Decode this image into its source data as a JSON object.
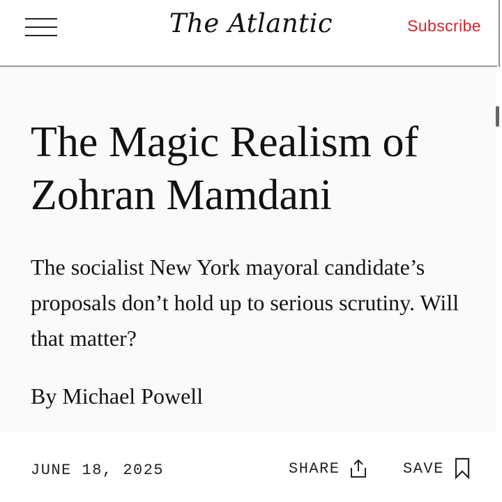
{
  "header": {
    "menu_icon": "hamburger-menu-icon",
    "logo_text": "The Atlantic",
    "subscribe_label": "Subscribe",
    "subscribe_color": "#d1262c"
  },
  "article": {
    "headline": "The Magic Realism of Zohran Mamdani",
    "dek": "The socialist New York mayoral candidate’s proposals don’t hold up to serious scrutiny. Will that matter?",
    "byline_prefix": "By",
    "author": "Michael Powell",
    "date": "JUNE 18, 2025"
  },
  "actions": {
    "share_label": "SHARE",
    "share_icon": "share-upload-icon",
    "save_label": "SAVE",
    "save_icon": "bookmark-icon"
  }
}
